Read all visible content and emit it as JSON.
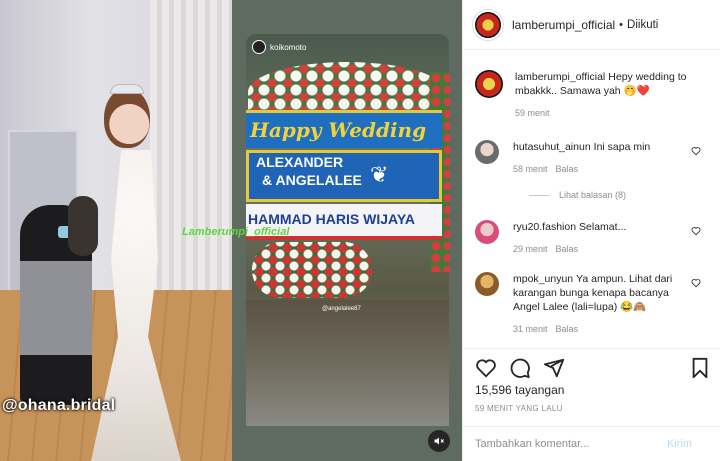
{
  "post": {
    "username": "lamberumpi_official",
    "follow_separator": "•",
    "follow_status": "Diikuti"
  },
  "media": {
    "left_tag": "@ohana.bridal",
    "watermark": "Lamberumpi_official",
    "story_user": "koikomoto",
    "banner_text": "Happy Wedding",
    "names_line1": "ALEXANDER",
    "names_line2": "& ANGELALEE",
    "sender_text": "HAMMAD HARIS WIJAYA",
    "ground_tag": "@angelalee87"
  },
  "comments": [
    {
      "username": "lamberumpi_official",
      "text": "Hepy wedding to mbakkk.. Samawa yah 🤭❤️",
      "time": "59 menit"
    },
    {
      "username": "hutasuhut_ainun",
      "text": "Ini sapa min",
      "time": "58 menit",
      "reply": "Balas"
    },
    {
      "view_replies": "Lihat balasan (8)"
    },
    {
      "username": "ryu20.fashion",
      "text": "Selamat...",
      "time": "29 menit",
      "reply": "Balas"
    },
    {
      "username": "mpok_unyun",
      "text": "Ya ampun. Lihat dari karangan bunga kenapa bacanya Angel Lalee (lali=lupa) 😂🙈",
      "time": "31 menit",
      "reply": "Balas"
    }
  ],
  "stats": {
    "views": "15,596 tayangan",
    "posted": "59 MENIT YANG LALU"
  },
  "composer": {
    "placeholder": "Tambahkan komentar...",
    "send_label": "Kirim"
  },
  "icons": [
    "heart-icon",
    "comment-icon",
    "share-icon",
    "bookmark-icon",
    "mute-icon"
  ],
  "colors": {
    "send_disabled": "#b2dffc",
    "meta_gray": "#8e8e8e",
    "text": "#262626"
  }
}
